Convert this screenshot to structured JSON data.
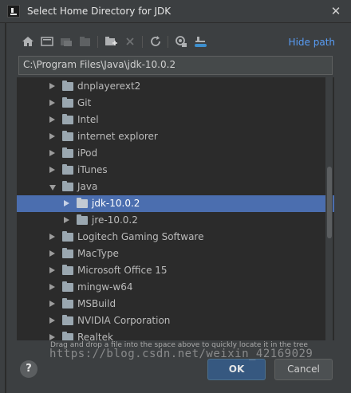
{
  "window": {
    "title": "Select Home Directory for JDK",
    "close_glyph": "✕"
  },
  "toolbar": {
    "icons": [
      "home-icon",
      "desktop-icon",
      "project-icon",
      "module-icon",
      "new-folder-icon",
      "delete-icon",
      "refresh-icon",
      "show-hidden-icon",
      "cloud-icon"
    ],
    "hide_path_label": "Hide path"
  },
  "path": {
    "value": "C:\\Program Files\\Java\\jdk-10.0.2"
  },
  "tree": {
    "items": [
      {
        "label": "dnplayerext2",
        "expanded": false,
        "selected": false,
        "depth": 0
      },
      {
        "label": "Git",
        "expanded": false,
        "selected": false,
        "depth": 0
      },
      {
        "label": "Intel",
        "expanded": false,
        "selected": false,
        "depth": 0
      },
      {
        "label": "internet explorer",
        "expanded": false,
        "selected": false,
        "depth": 0
      },
      {
        "label": "iPod",
        "expanded": false,
        "selected": false,
        "depth": 0
      },
      {
        "label": "iTunes",
        "expanded": false,
        "selected": false,
        "depth": 0
      },
      {
        "label": "Java",
        "expanded": true,
        "selected": false,
        "depth": 0
      },
      {
        "label": "jdk-10.0.2",
        "expanded": false,
        "selected": true,
        "depth": 1
      },
      {
        "label": "jre-10.0.2",
        "expanded": false,
        "selected": false,
        "depth": 1
      },
      {
        "label": "Logitech Gaming Software",
        "expanded": false,
        "selected": false,
        "depth": 0
      },
      {
        "label": "MacType",
        "expanded": false,
        "selected": false,
        "depth": 0
      },
      {
        "label": "Microsoft Office 15",
        "expanded": false,
        "selected": false,
        "depth": 0
      },
      {
        "label": "mingw-w64",
        "expanded": false,
        "selected": false,
        "depth": 0
      },
      {
        "label": "MSBuild",
        "expanded": false,
        "selected": false,
        "depth": 0
      },
      {
        "label": "NVIDIA Corporation",
        "expanded": false,
        "selected": false,
        "depth": 0
      },
      {
        "label": "Realtek",
        "expanded": false,
        "selected": false,
        "depth": 0
      }
    ]
  },
  "hint": "Drag and drop a file into the space above to quickly locate it in the tree",
  "buttons": {
    "help": "?",
    "ok": "OK",
    "cancel": "Cancel"
  },
  "watermark": "https://blog.csdn.net/weixin_42169029",
  "colors": {
    "accent": "#589df6",
    "selection": "#4b6eaf",
    "ok_button": "#365880"
  }
}
